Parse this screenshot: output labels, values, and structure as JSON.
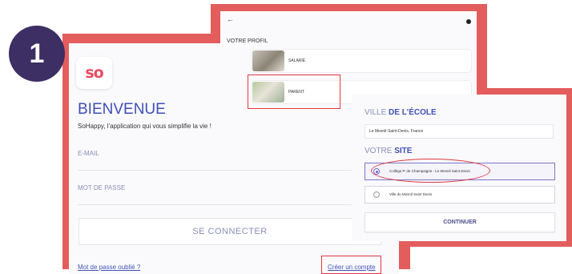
{
  "step_number": "1",
  "colors": {
    "accent_red": "#e35d5d",
    "highlight_red": "#e0393e",
    "brand_blue": "#3f4fb5",
    "step_purple": "#3d2e63",
    "logo_pink": "#e84a5f"
  },
  "login_screen": {
    "logo_text": "so",
    "title": "BIENVENUE",
    "tagline": "SoHappy, l'application qui vous simplifie la vie !",
    "email_label": "E-MAIL",
    "password_label": "MOT DE PASSE",
    "login_button": "SE CONNECTER",
    "forgot_password": "Mot de passe oublié ?",
    "create_account": "Créer un compte"
  },
  "profile_screen": {
    "back_icon": "arrow-left-icon",
    "info_icon": "info-dot-icon",
    "title": "VOTRE PROFIL",
    "options": [
      {
        "label": "SALARIÉ"
      },
      {
        "label": "PARENT"
      }
    ]
  },
  "school_screen": {
    "city_title_prefix": "VILLE",
    "city_title_bold": "DE L'ÉCOLE",
    "city_value": "Le Mesnil-Saint-Denis, France",
    "site_title_prefix": "VOTRE",
    "site_title_bold": "SITE",
    "sites": [
      {
        "label": "Collège P. de Champaigne - Le Mesnil Saint Denis",
        "selected": true
      },
      {
        "label": "Ville du Mesnil Saint Denis",
        "selected": false
      }
    ],
    "continue_button": "CONTINUER"
  }
}
